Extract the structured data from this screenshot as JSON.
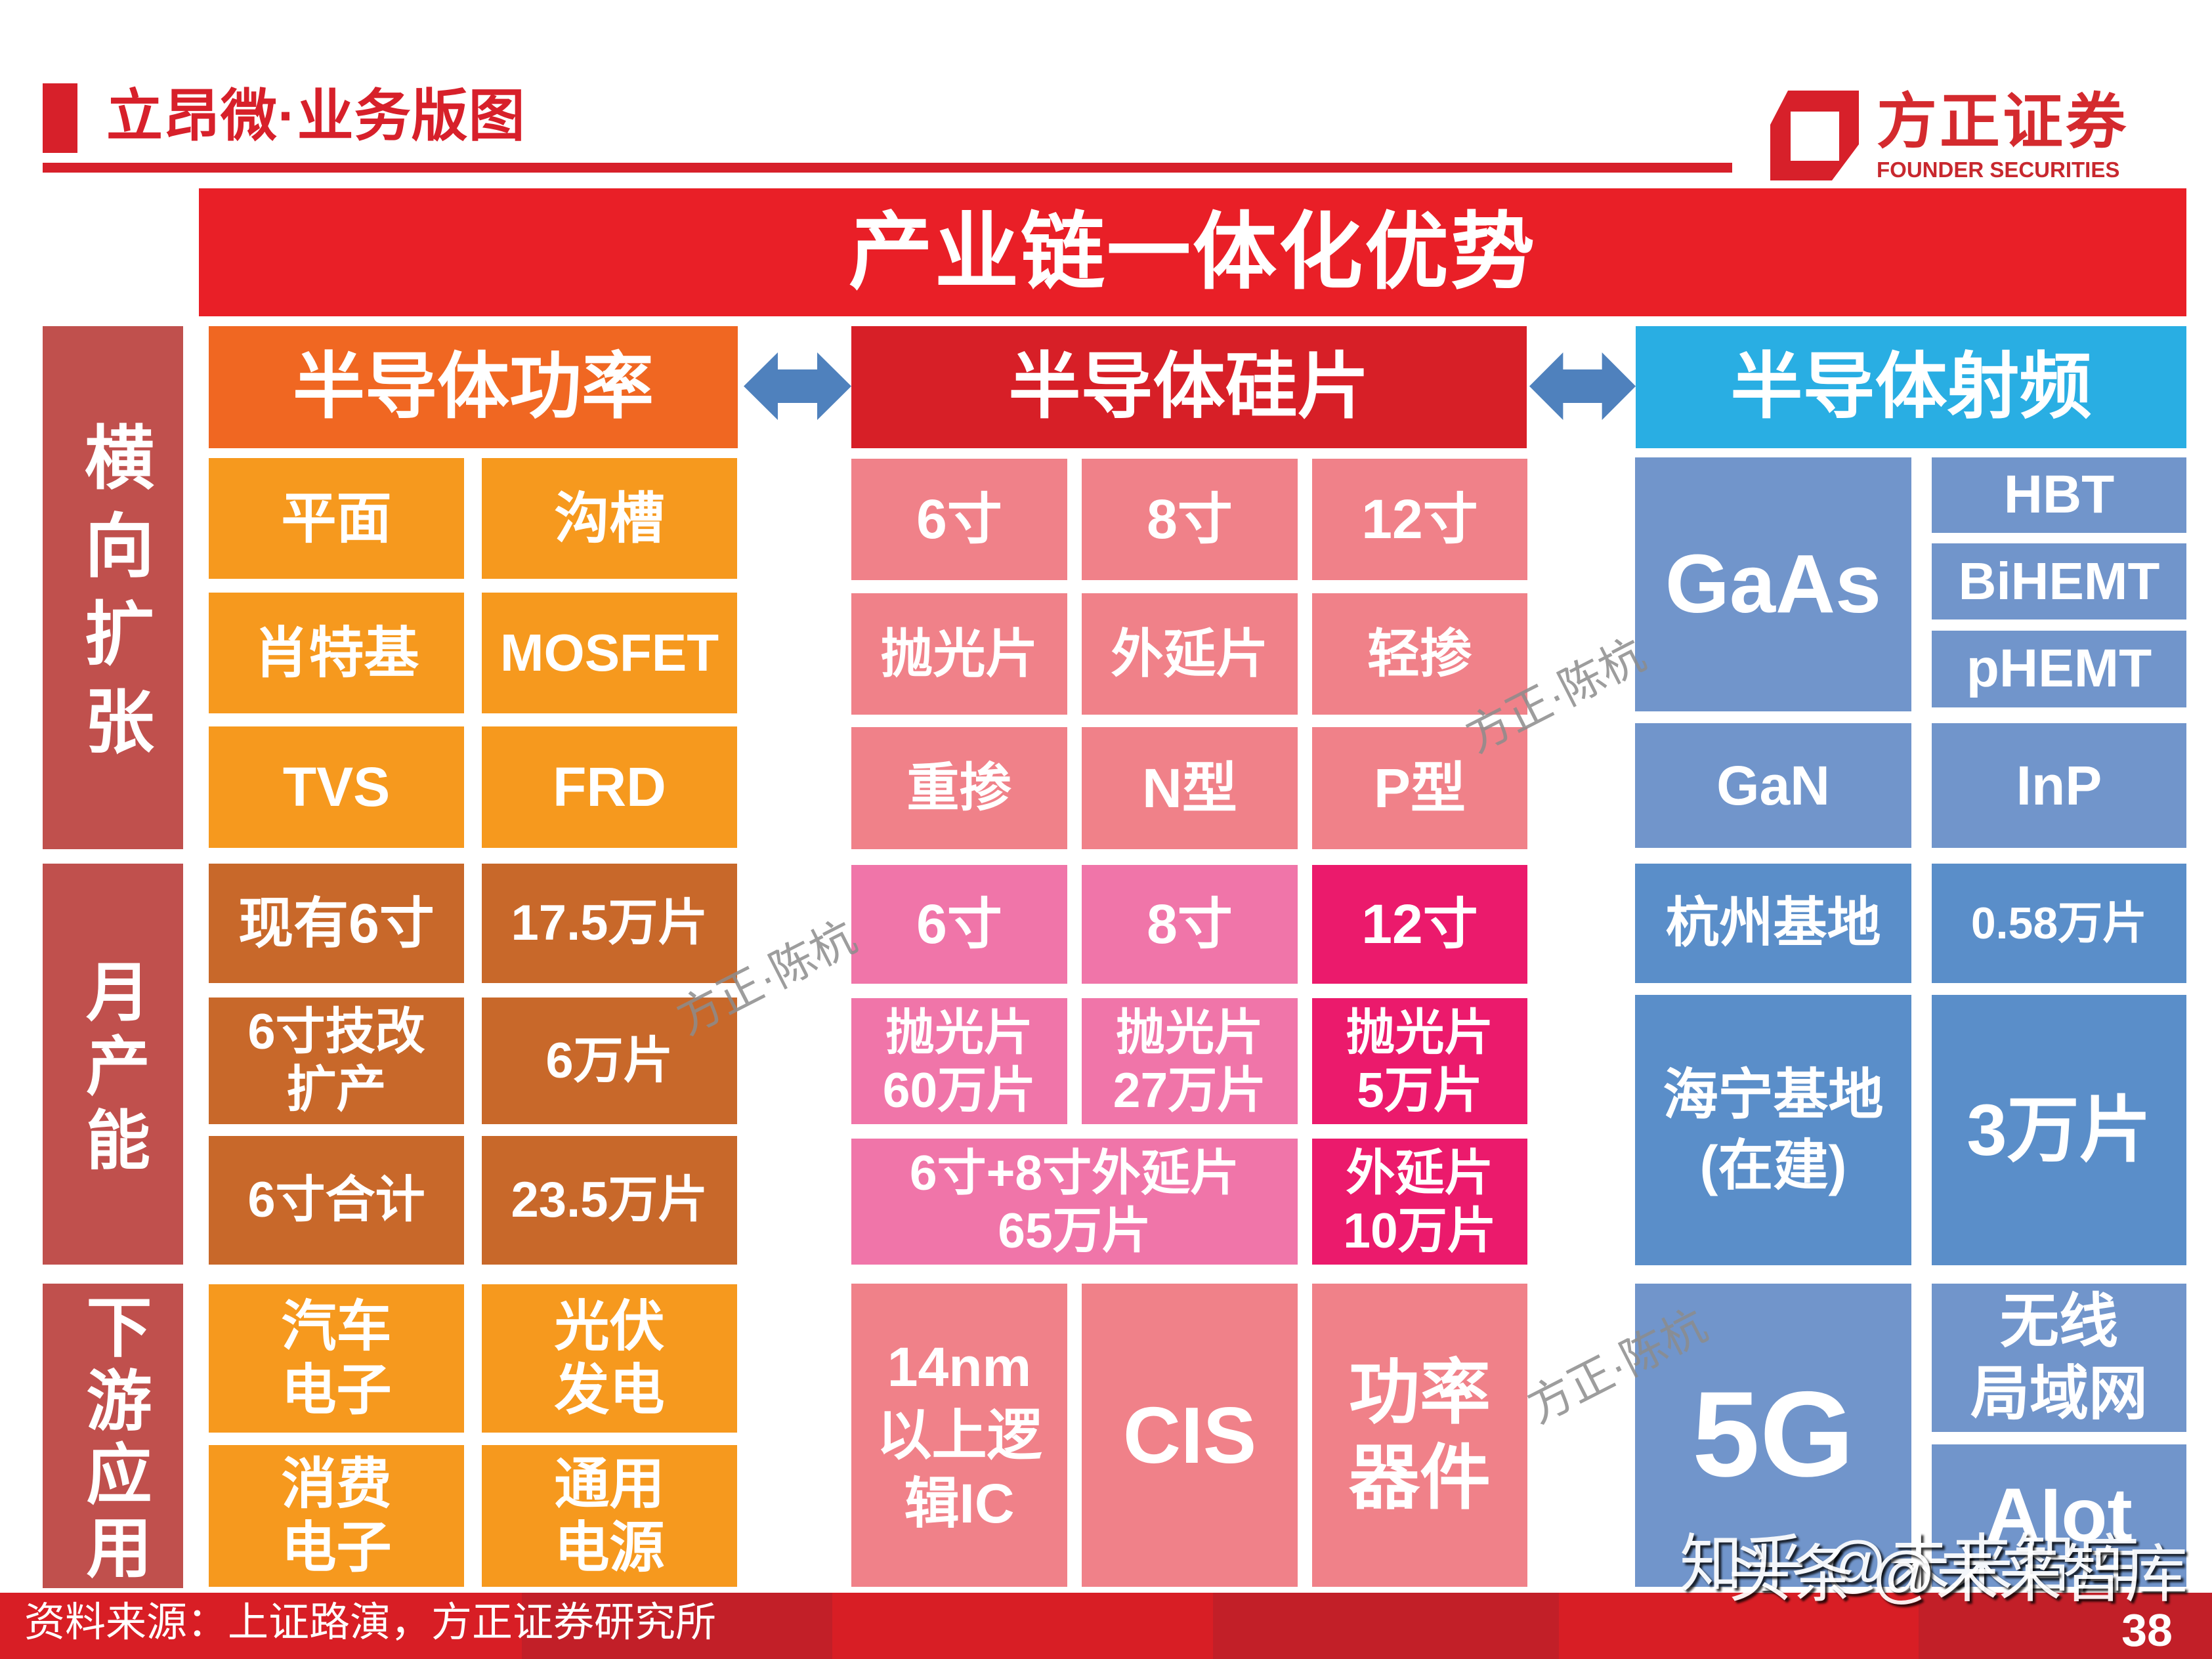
{
  "header": {
    "title": "立昂微·业务版图",
    "logo": {
      "name_cn": "方正证券",
      "name_en": "FOUNDER SECURITIES",
      "icon": "founder-logo-mark"
    }
  },
  "banner": {
    "title": "产业链一体化优势"
  },
  "row_labels": {
    "horizontal_expansion": "横向扩张",
    "monthly_capacity": "月产能",
    "downstream_applications": "下游应用"
  },
  "segments": {
    "power": {
      "title": "半导体功率",
      "products": [
        "平面",
        "沟槽",
        "肖特基",
        "MOSFET",
        "TVS",
        "FRD"
      ],
      "capacity": [
        {
          "label": "现有6寸",
          "value": "17.5万片"
        },
        {
          "label": "6寸技改\n扩产",
          "value": "6万片"
        },
        {
          "label": "6寸合计",
          "value": "23.5万片"
        }
      ],
      "applications": [
        "汽车\n电子",
        "光伏\n发电",
        "消费\n电子",
        "通用\n电源"
      ]
    },
    "wafer": {
      "title": "半导体硅片",
      "products": [
        "6寸",
        "8寸",
        "12寸",
        "抛光片",
        "外延片",
        "轻掺",
        "重掺",
        "N型",
        "P型"
      ],
      "capacity": {
        "sizes": [
          "6寸",
          "8寸",
          "12寸"
        ],
        "polished": [
          "抛光片\n60万片",
          "抛光片\n27万片",
          "抛光片\n5万片"
        ],
        "epitaxial_6_8": "6寸+8寸外延片\n65万片",
        "epitaxial_12": "外延片\n10万片"
      },
      "applications": [
        "14nm\n以上逻\n辑IC",
        "CIS",
        "功率\n器件"
      ]
    },
    "rf": {
      "title": "半导体射频",
      "materials": {
        "gaas": "GaAs",
        "gaas_types": [
          "HBT",
          "BiHEMT",
          "pHEMT"
        ],
        "gan": "GaN",
        "inp": "InP"
      },
      "capacity": [
        {
          "label": "杭州基地",
          "value": "0.58万片"
        },
        {
          "label": "海宁基地\n(在建)",
          "value": "3万片"
        }
      ],
      "applications": [
        "5G",
        "无线\n局域网",
        "AIot"
      ]
    }
  },
  "connectors": {
    "icon": "double-arrow-icon"
  },
  "watermarks": {
    "author": "方正·陈杭",
    "zhihu": "知乎 @未来智库",
    "toutiao": "头条 @未来智库"
  },
  "footer": {
    "source": "资料来源：上证路演，方正证券研究所",
    "page_number": "38"
  },
  "colors": {
    "brand_red": "#d7202a",
    "banner_red": "#e91f27",
    "row_label": "#c0504d",
    "power_header": "#f06722",
    "power_cell": "#f6991e",
    "power_capacity": "#c8682a",
    "wafer_header": "#d71f27",
    "wafer_cell": "#f08189",
    "wafer_capacity_light": "#f075a9",
    "wafer_capacity_deep": "#eb1a6c",
    "rf_header": "#29aee3",
    "rf_cell": "#7195cb",
    "rf_capacity": "#5a8ec9",
    "arrow": "#4f81bd",
    "footer_red": "#d81e25",
    "footer_red_dark": "#c21f28"
  }
}
